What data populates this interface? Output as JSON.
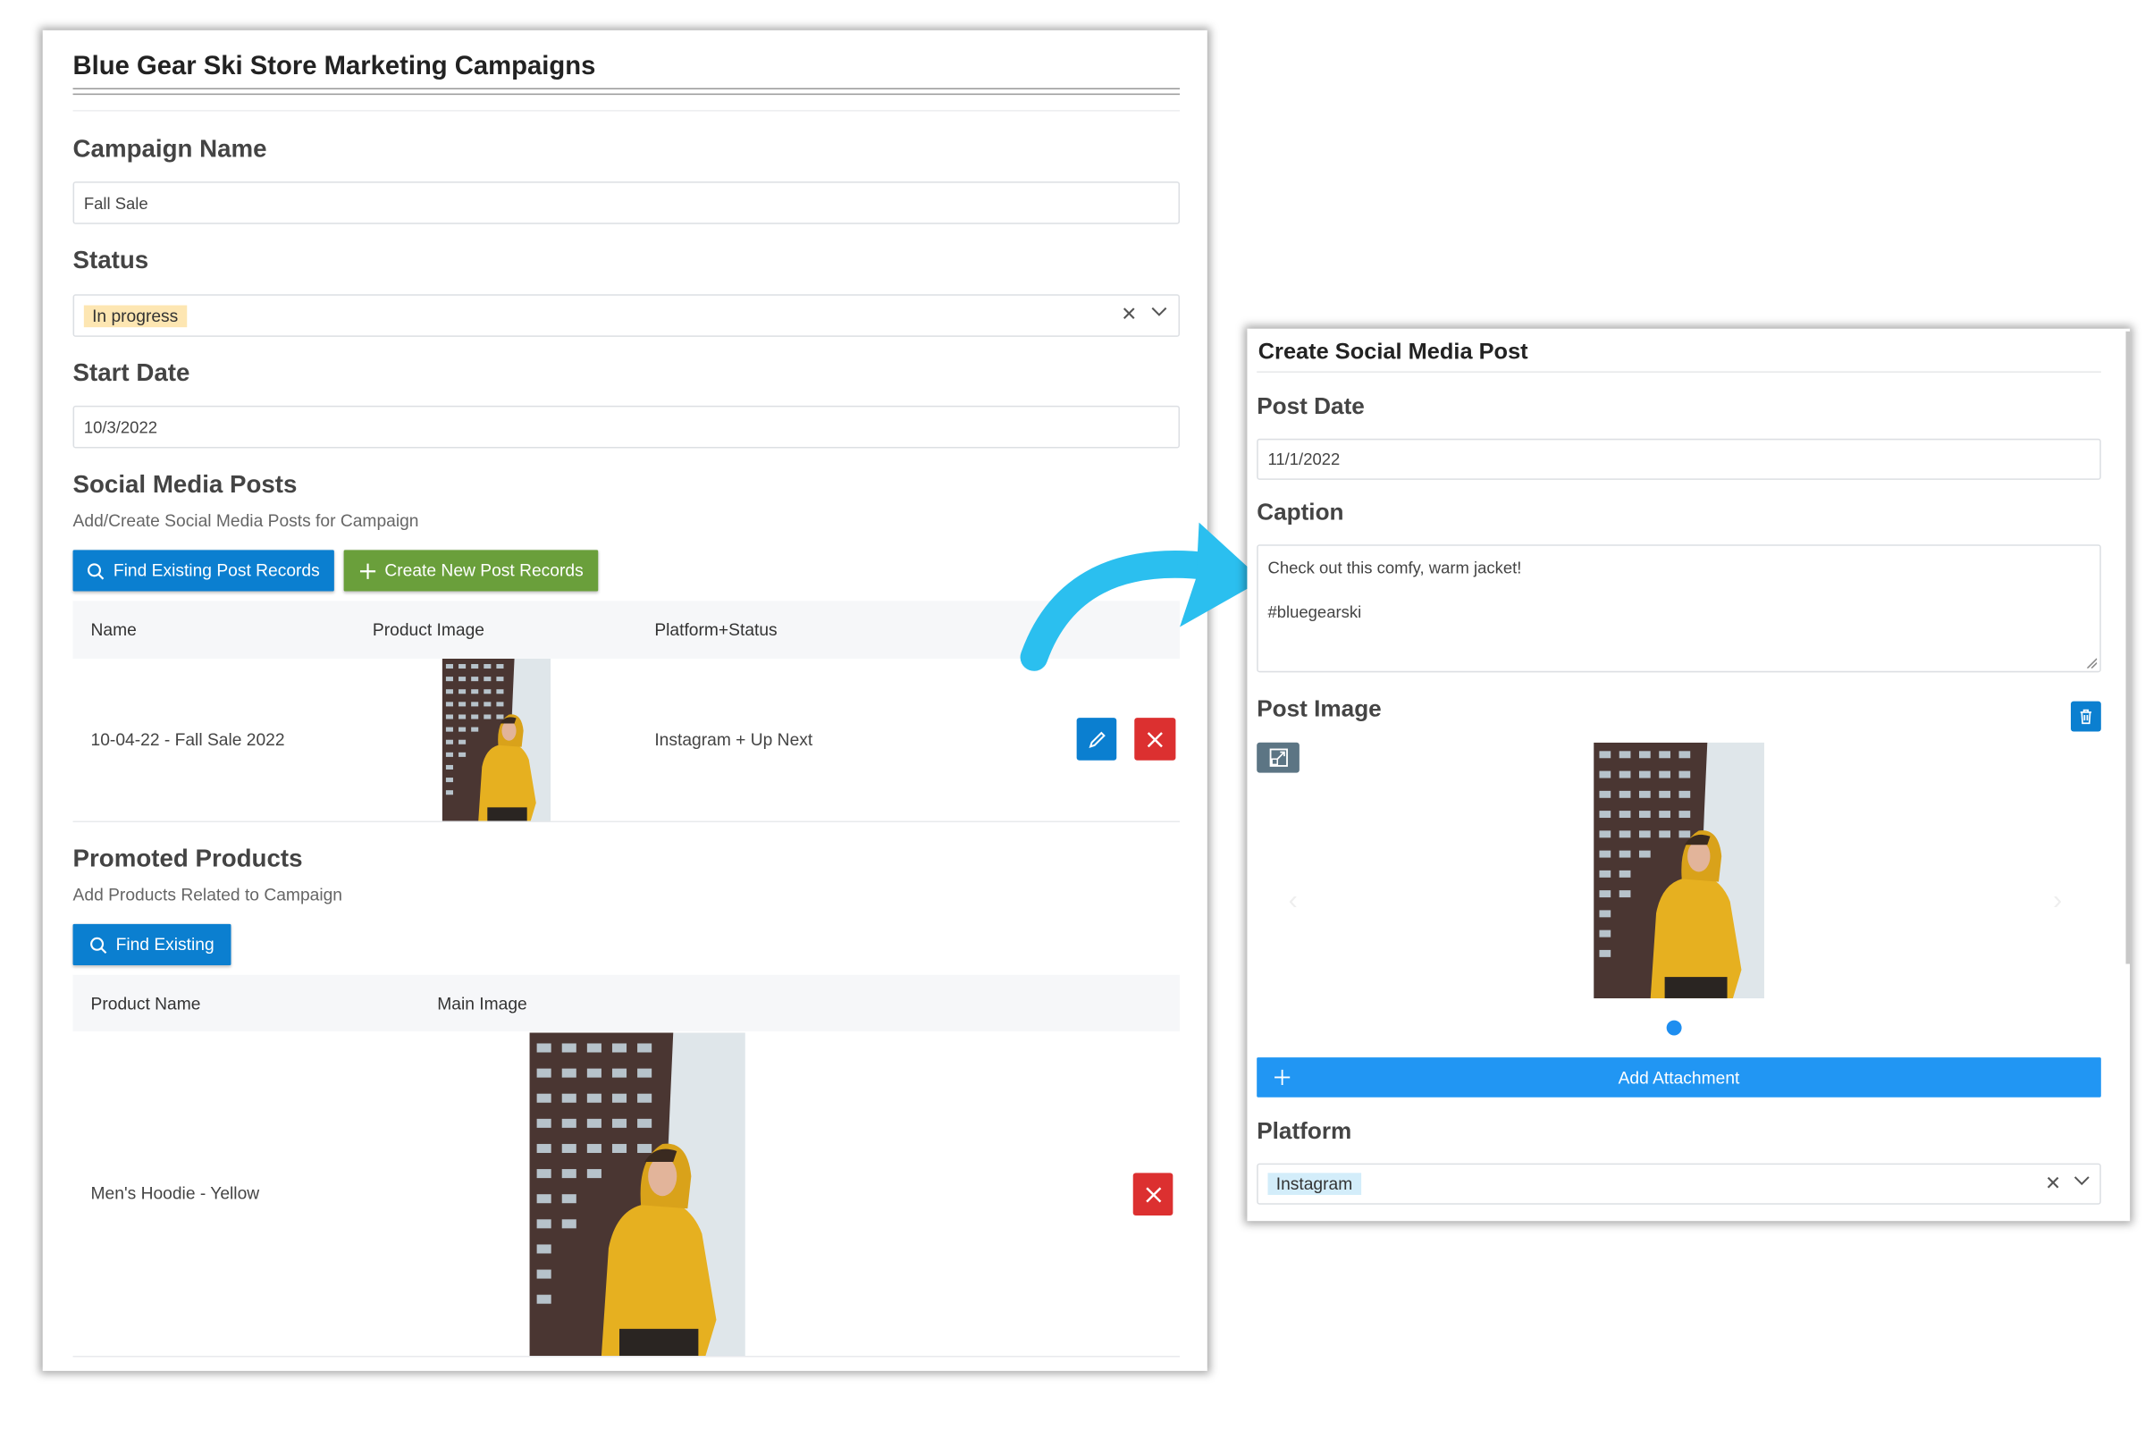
{
  "campaign_form": {
    "title": "Blue Gear Ski Store Marketing Campaigns",
    "campaign_name": {
      "label": "Campaign Name",
      "value": "Fall Sale"
    },
    "status": {
      "label": "Status",
      "value": "In progress",
      "badge_color": "#fde6b2"
    },
    "start_date": {
      "label": "Start Date",
      "value": "10/3/2022"
    },
    "social_media_posts": {
      "title": "Social Media Posts",
      "subtitle": "Add/Create Social Media Posts for Campaign",
      "find_button": "Find Existing Post Records",
      "create_button": "Create New Post Records",
      "columns": [
        "Name",
        "Product Image",
        "Platform+Status"
      ],
      "rows": [
        {
          "name": "10-04-22 - Fall Sale 2022",
          "platform_status": "Instagram + Up Next"
        }
      ]
    },
    "promoted_products": {
      "title": "Promoted Products",
      "subtitle": "Add Products Related to Campaign",
      "find_button": "Find Existing",
      "columns": [
        "Product Name",
        "Main Image"
      ],
      "rows": [
        {
          "name": "Men's Hoodie - Yellow"
        }
      ]
    }
  },
  "post_form": {
    "title": "Create Social Media Post",
    "post_date": {
      "label": "Post Date",
      "value": "11/1/2022"
    },
    "caption": {
      "label": "Caption",
      "value": "Check out this comfy, warm jacket!\n\n#bluegearski"
    },
    "post_image": {
      "label": "Post Image",
      "image_count": 1,
      "active_index": 1
    },
    "add_attachment": "Add Attachment",
    "platform": {
      "label": "Platform",
      "value": "Instagram",
      "badge_color": "#d3edfa"
    }
  },
  "colors": {
    "primary_blue": "#0b7fd0",
    "green": "#6a9f3b",
    "danger_red": "#dc3030",
    "attachment_blue": "#2196f3",
    "arrow": "#2bbfef"
  }
}
